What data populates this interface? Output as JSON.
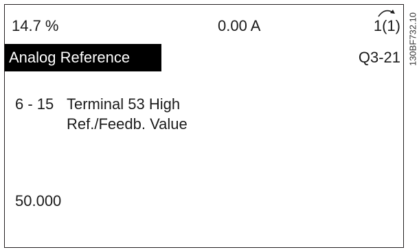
{
  "status_line": {
    "reference": "14.7 %",
    "current": "0.00 A",
    "setup": "1(1)"
  },
  "title_bar": {
    "title": "Analog Reference",
    "menu_code": "Q3-21"
  },
  "parameter": {
    "number": "6 - 15",
    "name_line1": "Terminal 53 High",
    "name_line2": "Ref./Feedb. Value",
    "value": "50.000"
  },
  "figure_code": "130BF732.10",
  "icons": {
    "setup_indicator": "curved-arrow-icon"
  },
  "colors": {
    "title_bar_bg": "#000000",
    "title_bar_text": "#ffffff",
    "text": "#1a1a1a"
  }
}
